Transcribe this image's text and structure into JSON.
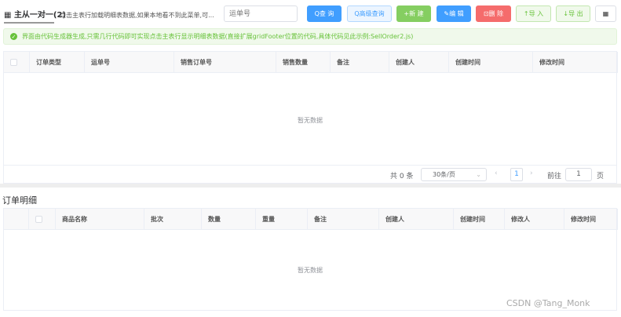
{
  "header": {
    "tab_title": "主从一对一(2)",
    "tab_desc": "点击主表行加载明细表数据,如果本地看不到此菜单,可...",
    "search": {
      "placeholder": "运单号",
      "value": ""
    }
  },
  "toolbar": {
    "buttons": [
      {
        "label": "Q查 询",
        "bg": "#409eff",
        "fg": "#fff",
        "border": "#409eff"
      },
      {
        "label": "Q高级查询",
        "bg": "#ecf5ff",
        "fg": "#409eff",
        "border": "#b3d8ff"
      },
      {
        "label": "+新 建",
        "bg": "#85ce61",
        "fg": "#fff",
        "border": "#85ce61"
      },
      {
        "label": "✎编 辑",
        "bg": "#409eff",
        "fg": "#fff",
        "border": "#409eff"
      },
      {
        "label": "⊡删 除",
        "bg": "#f56c6c",
        "fg": "#fff",
        "border": "#f56c6c"
      },
      {
        "label": "↑导 入",
        "bg": "#f0f9eb",
        "fg": "#67c23a",
        "border": "#c2e7b0"
      },
      {
        "label": "↓导 出",
        "bg": "#f0f9eb",
        "fg": "#67c23a",
        "border": "#c2e7b0"
      },
      {
        "label": "▦",
        "bg": "#fff",
        "fg": "#333",
        "border": "#dcdfe6"
      }
    ]
  },
  "alert": {
    "text": "界面由代码生成器生成,只需几行代码即可实现点击主表行显示明细表数据(直接扩展gridFooter位置的代码,具体代码见此示例:SellOrder2.js)",
    "color": "#67c23a"
  },
  "main_table": {
    "columns": [
      "订单类型",
      "运单号",
      "销售订单号",
      "销售数量",
      "备注",
      "创建人",
      "创建时间",
      "修改时间"
    ],
    "empty": "暂无数据"
  },
  "pager": {
    "total": "共 0 条",
    "page_size": "30条/页",
    "current": "1",
    "goto_label": "前往",
    "goto_value": "1",
    "page_suffix": "页"
  },
  "detail": {
    "title": "订单明细",
    "columns": [
      "商品名称",
      "批次",
      "数量",
      "重量",
      "备注",
      "创建人",
      "创建时间",
      "修改人",
      "修改时间"
    ],
    "empty": "暂无数据"
  },
  "watermark": "CSDN @Tang_Monk"
}
